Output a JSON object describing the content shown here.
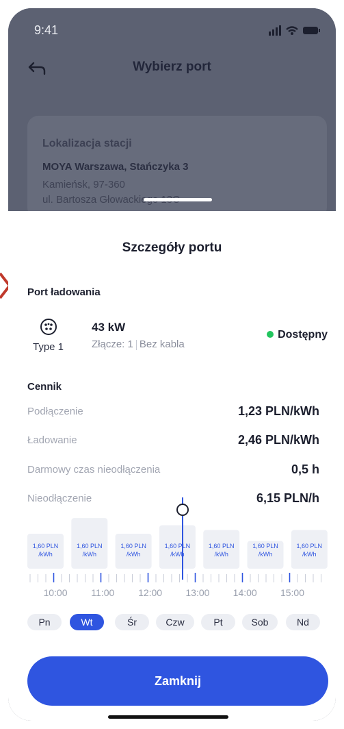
{
  "status_bar": {
    "time": "9:41"
  },
  "header": {
    "title": "Wybierz port"
  },
  "location": {
    "heading": "Lokalizacja stacji",
    "name": "MOYA Warszawa, Stańczyka 3",
    "line1": "Kamieńsk, 97-360",
    "line2": "ul. Bartosza Głowackiego 13C"
  },
  "sheet": {
    "title": "Szczegóły portu",
    "port_section": "Port ładowania",
    "port": {
      "type": "Type 1",
      "power": "43 kW",
      "connector": "Złącze: 1",
      "cable": "Bez kabla",
      "status": "Dostępny",
      "status_color": "#22c55e"
    },
    "pricing_section": "Cennik",
    "pricing": [
      {
        "label": "Podłączenie",
        "value": "1,23 PLN/kWh"
      },
      {
        "label": "Ładowanie",
        "value": "2,46 PLN/kWh"
      },
      {
        "label": "Darmowy czas nieodłączenia",
        "value": "0,5 h"
      },
      {
        "label": "Nieodłączenie",
        "value": "6,15 PLN/h"
      }
    ],
    "close_label": "Zamknij"
  },
  "chart_data": {
    "type": "bar",
    "categories": [
      "10:00",
      "",
      "11:00",
      "",
      "12:00",
      "",
      "13:00"
    ],
    "bar_label": "1,60 PLN /kWh",
    "relative_heights": [
      0.58,
      0.84,
      0.58,
      0.72,
      0.64,
      0.46,
      0.64
    ],
    "x_tick_labels": [
      "10:00",
      "11:00",
      "12:00",
      "13:00",
      "14:00",
      "15:00"
    ],
    "current_time_marker": "12:30",
    "accent": "#2f55e0"
  },
  "days": [
    {
      "label": "Pn",
      "active": false
    },
    {
      "label": "Wt",
      "active": true
    },
    {
      "label": "Śr",
      "active": false
    },
    {
      "label": "Czw",
      "active": false
    },
    {
      "label": "Pt",
      "active": false
    },
    {
      "label": "Sob",
      "active": false
    },
    {
      "label": "Nd",
      "active": false
    }
  ],
  "colors": {
    "primary": "#2f55e0",
    "overlay": "#5c6172"
  }
}
